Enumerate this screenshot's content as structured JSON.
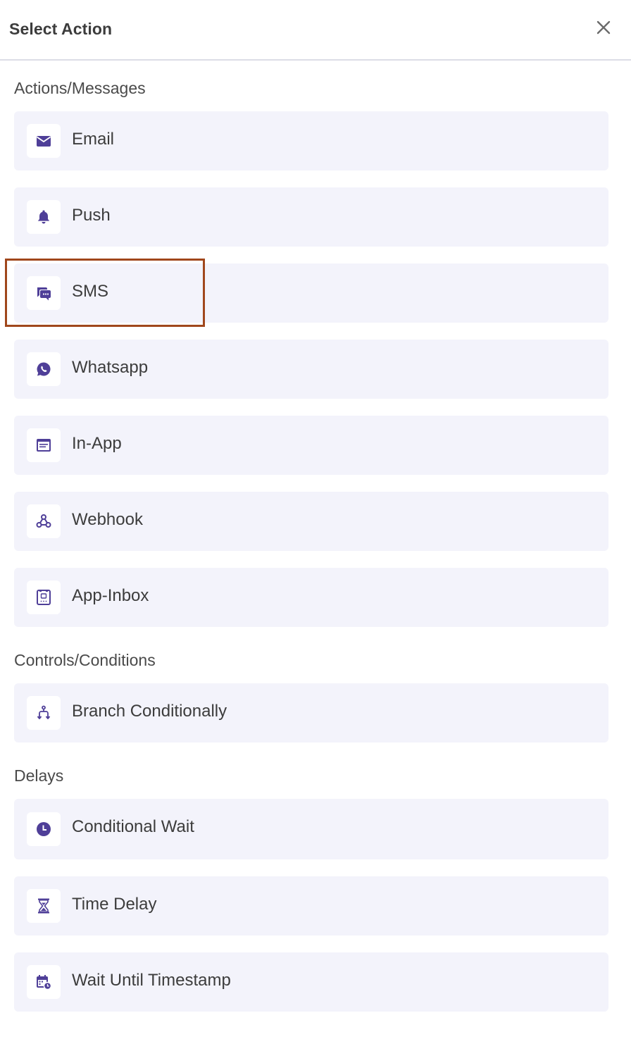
{
  "header": {
    "title": "Select Action",
    "close_icon": "close-icon"
  },
  "colors": {
    "accent": "#4f3f98",
    "item_bg": "#f3f3fb",
    "highlight": "#a0471c"
  },
  "sections": [
    {
      "label": "Actions/Messages",
      "items": [
        {
          "label": "Email",
          "icon": "email-icon"
        },
        {
          "label": "Push",
          "icon": "bell-icon"
        },
        {
          "label": "SMS",
          "icon": "sms-icon"
        },
        {
          "label": "Whatsapp",
          "icon": "whatsapp-icon"
        },
        {
          "label": "In-App",
          "icon": "in-app-icon"
        },
        {
          "label": "Webhook",
          "icon": "webhook-icon"
        },
        {
          "label": "App-Inbox",
          "icon": "app-inbox-icon"
        }
      ]
    },
    {
      "label": "Controls/Conditions",
      "items": [
        {
          "label": "Branch Conditionally",
          "icon": "branch-icon"
        }
      ]
    },
    {
      "label": "Delays",
      "items": [
        {
          "label": "Conditional Wait",
          "icon": "clock-icon"
        },
        {
          "label": "Time Delay",
          "icon": "hourglass-icon"
        },
        {
          "label": "Wait Until Timestamp",
          "icon": "calendar-clock-icon"
        }
      ]
    }
  ]
}
